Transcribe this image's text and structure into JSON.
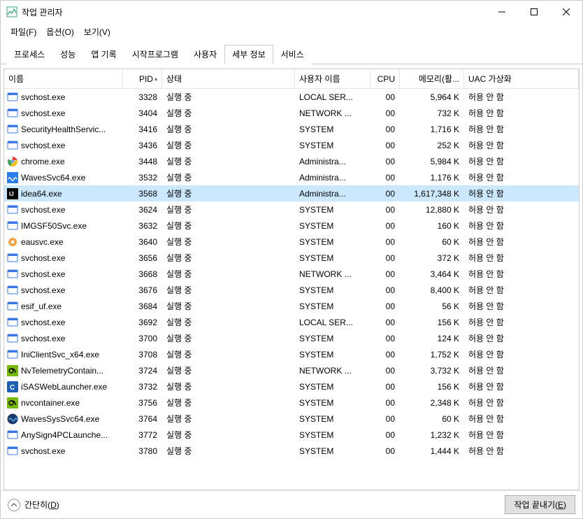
{
  "window": {
    "title": "작업 관리자"
  },
  "menu": {
    "file": "파일(F)",
    "options": "옵션(O)",
    "view": "보기(V)"
  },
  "tabs": {
    "items": [
      "프로세스",
      "성능",
      "앱 기록",
      "시작프로그램",
      "사용자",
      "세부 정보",
      "서비스"
    ],
    "active_index": 5
  },
  "columns": {
    "name": "이름",
    "pid": "PID",
    "status": "상태",
    "user": "사용자 이름",
    "cpu": "CPU",
    "mem": "메모리(활...",
    "uac": "UAC 가상화",
    "sort": {
      "col": "pid",
      "dir": "asc"
    }
  },
  "footer": {
    "fewer": "간단히(D)",
    "end_task": "작업 끝내기(E)"
  },
  "selected_pid": 3568,
  "processes": [
    {
      "name": "svchost.exe",
      "pid": 3328,
      "status": "실행 중",
      "user": "LOCAL SER...",
      "cpu": "00",
      "mem": "5,964 K",
      "uac": "허용 안 함",
      "icon": "generic"
    },
    {
      "name": "svchost.exe",
      "pid": 3404,
      "status": "실행 중",
      "user": "NETWORK ...",
      "cpu": "00",
      "mem": "732 K",
      "uac": "허용 안 함",
      "icon": "generic"
    },
    {
      "name": "SecurityHealthServic...",
      "pid": 3416,
      "status": "실행 중",
      "user": "SYSTEM",
      "cpu": "00",
      "mem": "1,716 K",
      "uac": "허용 안 함",
      "icon": "generic"
    },
    {
      "name": "svchost.exe",
      "pid": 3436,
      "status": "실행 중",
      "user": "SYSTEM",
      "cpu": "00",
      "mem": "252 K",
      "uac": "허용 안 함",
      "icon": "generic"
    },
    {
      "name": "chrome.exe",
      "pid": 3448,
      "status": "실행 중",
      "user": "Administra...",
      "cpu": "00",
      "mem": "5,984 K",
      "uac": "허용 안 함",
      "icon": "chrome"
    },
    {
      "name": "WavesSvc64.exe",
      "pid": 3532,
      "status": "실행 중",
      "user": "Administra...",
      "cpu": "00",
      "mem": "1,176 K",
      "uac": "허용 안 함",
      "icon": "waves"
    },
    {
      "name": "idea64.exe",
      "pid": 3568,
      "status": "실행 중",
      "user": "Administra...",
      "cpu": "00",
      "mem": "1,617,348 K",
      "uac": "허용 안 함",
      "icon": "idea"
    },
    {
      "name": "svchost.exe",
      "pid": 3624,
      "status": "실행 중",
      "user": "SYSTEM",
      "cpu": "00",
      "mem": "12,880 K",
      "uac": "허용 안 함",
      "icon": "generic"
    },
    {
      "name": "IMGSF50Svc.exe",
      "pid": 3632,
      "status": "실행 중",
      "user": "SYSTEM",
      "cpu": "00",
      "mem": "160 K",
      "uac": "허용 안 함",
      "icon": "generic"
    },
    {
      "name": "eausvc.exe",
      "pid": 3640,
      "status": "실행 중",
      "user": "SYSTEM",
      "cpu": "00",
      "mem": "60 K",
      "uac": "허용 안 함",
      "icon": "eau"
    },
    {
      "name": "svchost.exe",
      "pid": 3656,
      "status": "실행 중",
      "user": "SYSTEM",
      "cpu": "00",
      "mem": "372 K",
      "uac": "허용 안 함",
      "icon": "generic"
    },
    {
      "name": "svchost.exe",
      "pid": 3668,
      "status": "실행 중",
      "user": "NETWORK ...",
      "cpu": "00",
      "mem": "3,464 K",
      "uac": "허용 안 함",
      "icon": "generic"
    },
    {
      "name": "svchost.exe",
      "pid": 3676,
      "status": "실행 중",
      "user": "SYSTEM",
      "cpu": "00",
      "mem": "8,400 K",
      "uac": "허용 안 함",
      "icon": "generic"
    },
    {
      "name": "esif_uf.exe",
      "pid": 3684,
      "status": "실행 중",
      "user": "SYSTEM",
      "cpu": "00",
      "mem": "56 K",
      "uac": "허용 안 함",
      "icon": "generic"
    },
    {
      "name": "svchost.exe",
      "pid": 3692,
      "status": "실행 중",
      "user": "LOCAL SER...",
      "cpu": "00",
      "mem": "156 K",
      "uac": "허용 안 함",
      "icon": "generic"
    },
    {
      "name": "svchost.exe",
      "pid": 3700,
      "status": "실행 중",
      "user": "SYSTEM",
      "cpu": "00",
      "mem": "124 K",
      "uac": "허용 안 함",
      "icon": "generic"
    },
    {
      "name": "IniClientSvc_x64.exe",
      "pid": 3708,
      "status": "실행 중",
      "user": "SYSTEM",
      "cpu": "00",
      "mem": "1,752 K",
      "uac": "허용 안 함",
      "icon": "generic"
    },
    {
      "name": "NvTelemetryContain...",
      "pid": 3724,
      "status": "실행 중",
      "user": "NETWORK ...",
      "cpu": "00",
      "mem": "3,732 K",
      "uac": "허용 안 함",
      "icon": "nvidia"
    },
    {
      "name": "iSASWebLauncher.exe",
      "pid": 3732,
      "status": "실행 중",
      "user": "SYSTEM",
      "cpu": "00",
      "mem": "156 K",
      "uac": "허용 안 함",
      "icon": "isas"
    },
    {
      "name": "nvcontainer.exe",
      "pid": 3756,
      "status": "실행 중",
      "user": "SYSTEM",
      "cpu": "00",
      "mem": "2,348 K",
      "uac": "허용 안 함",
      "icon": "nvidia"
    },
    {
      "name": "WavesSysSvc64.exe",
      "pid": 3764,
      "status": "실행 중",
      "user": "SYSTEM",
      "cpu": "00",
      "mem": "60 K",
      "uac": "허용 안 함",
      "icon": "wavessys"
    },
    {
      "name": "AnySign4PCLaunche...",
      "pid": 3772,
      "status": "실행 중",
      "user": "SYSTEM",
      "cpu": "00",
      "mem": "1,232 K",
      "uac": "허용 안 함",
      "icon": "generic"
    },
    {
      "name": "svchost.exe",
      "pid": 3780,
      "status": "실행 중",
      "user": "SYSTEM",
      "cpu": "00",
      "mem": "1,444 K",
      "uac": "허용 안 함",
      "icon": "generic"
    }
  ]
}
